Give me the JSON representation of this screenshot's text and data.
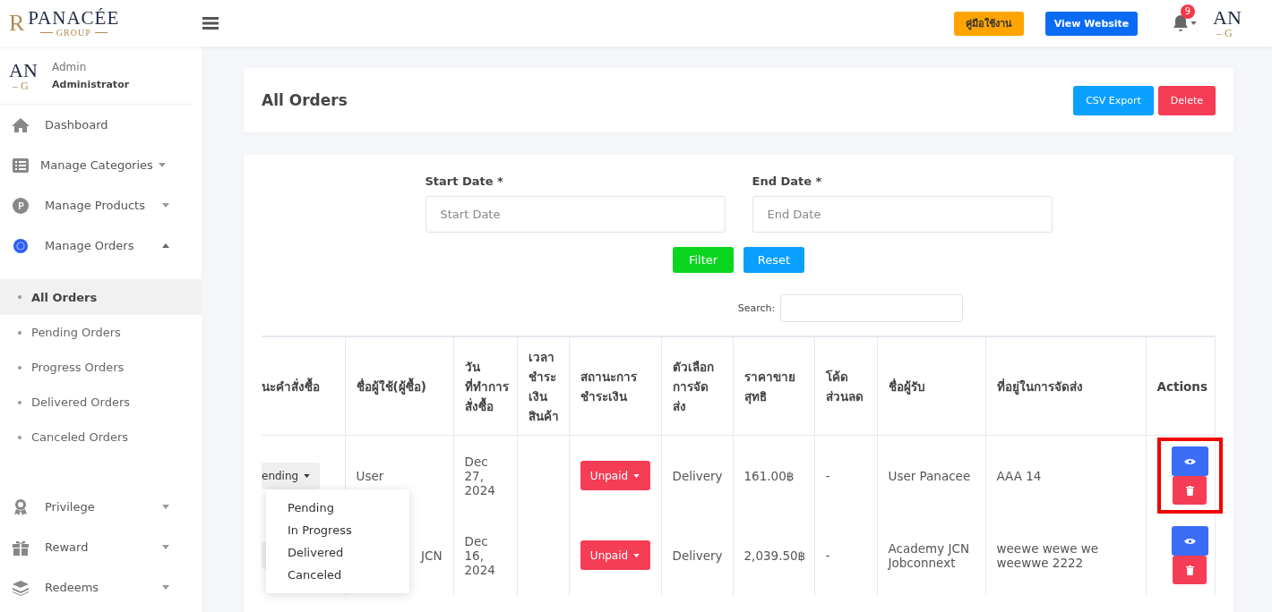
{
  "header": {
    "logo": {
      "name": "PANACÉE",
      "sub": "GROUP",
      "mark": "R"
    },
    "manual_button": "คู่มือใช้งาน",
    "website_button": "View Website",
    "notifications": "9",
    "avatar": {
      "line1": "AN",
      "line2": "– G"
    }
  },
  "sidebar": {
    "user": {
      "name": "Admin",
      "role": "Administrator",
      "logo1": "AN",
      "logo2": "– G"
    },
    "items": [
      {
        "label": "Dashboard",
        "kind": "home"
      },
      {
        "label": "Manage Categories",
        "kind": "list",
        "expanded": false
      },
      {
        "label": "Manage Products",
        "kind": "product",
        "expanded": false
      },
      {
        "label": "Manage Orders",
        "kind": "orders",
        "expanded": true,
        "children": [
          {
            "label": "All Orders",
            "selected": true
          },
          {
            "label": "Pending Orders",
            "selected": false
          },
          {
            "label": "Progress Orders",
            "selected": false
          },
          {
            "label": "Delivered Orders",
            "selected": false
          },
          {
            "label": "Canceled Orders",
            "selected": false
          }
        ]
      },
      {
        "label": "Privilege",
        "kind": "award",
        "expanded": false
      },
      {
        "label": "Reward",
        "kind": "gift",
        "expanded": false
      },
      {
        "label": "Redeems",
        "kind": "layers",
        "expanded": false
      }
    ]
  },
  "page": {
    "title": "All Orders",
    "csv_button": "CSV Export",
    "delete_button": "Delete"
  },
  "filters": {
    "start_label": "Start Date *",
    "start_placeholder": "Start Date",
    "end_label": "End Date *",
    "end_placeholder": "End Date",
    "filter_button": "Filter",
    "reset_button": "Reset",
    "search_label": "Search:"
  },
  "table": {
    "columns": [
      "นะคำสั่งซื้อ",
      "ชื่อผู้ใช้(ผู้ซื้อ)",
      "วัน ที่ทำการ สั่งซื้อ",
      "เวลา ชำระ เงิน สินค้า",
      "สถานะการ ชำระเงิน",
      "ตัวเลือก การจัด ส่ง",
      "ราคาขาย สุทธิ",
      "โค้ด ส่วนลด",
      "ชื่อผู้รับ",
      "ที่อยู่ในการจัดส่ง",
      "Actions"
    ],
    "rows": [
      {
        "status": "ending",
        "user": "User",
        "date": "Dec 27, 2024",
        "payment": "Unpaid",
        "delivery": "Delivery",
        "price": "161.00฿",
        "discount": "-",
        "recipient": "User Panacee",
        "address": "AAA 14",
        "highlighted": true
      },
      {
        "user": "JCN",
        "date": "Dec 16, 2024",
        "payment": "Unpaid",
        "delivery": "Delivery",
        "price": "2,039.50฿",
        "discount": "-",
        "recipient": "Academy JCN Jobconnext",
        "address": "weewe wewe we weewwe 2222"
      }
    ]
  },
  "status_menu": [
    "Pending",
    "In Progress",
    "Delivered",
    "Canceled"
  ]
}
